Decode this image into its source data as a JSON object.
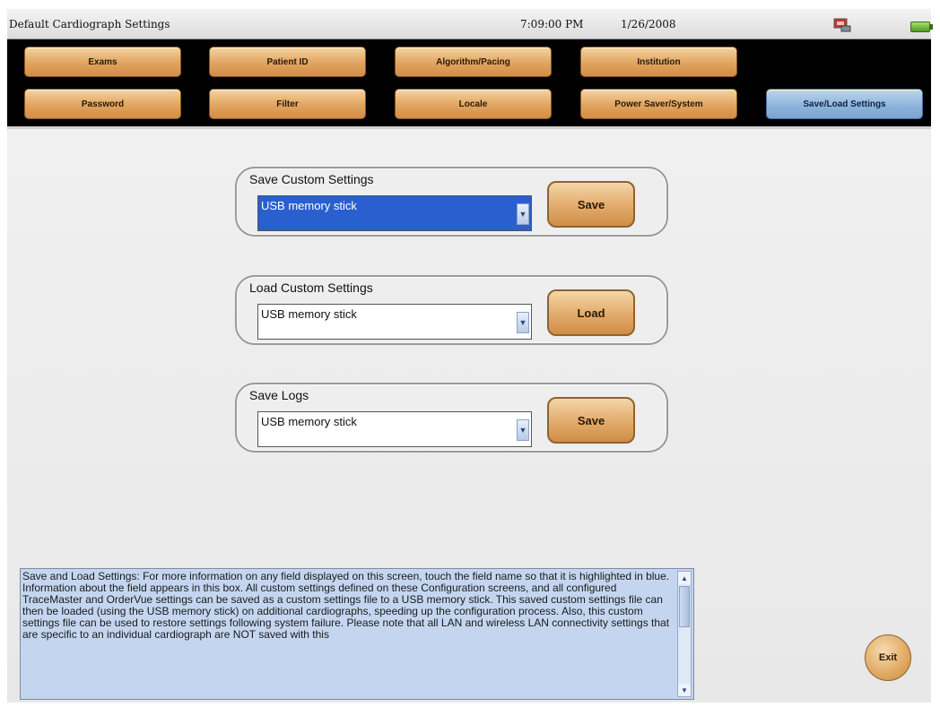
{
  "window": {
    "title": "Default Cardiograph Settings",
    "time": "7:09:00 PM",
    "date": "1/26/2008"
  },
  "nav": {
    "exams": "Exams",
    "patient_id": "Patient ID",
    "algorithm_pacing": "Algorithm/Pacing",
    "institution": "Institution",
    "password": "Password",
    "filter": "Filter",
    "locale": "Locale",
    "power_saver_system": "Power Saver/System",
    "save_load_settings": "Save/Load Settings"
  },
  "save_custom": {
    "label": "Save Custom Settings",
    "selected": "USB memory stick",
    "button": "Save"
  },
  "load_custom": {
    "label": "Load Custom Settings",
    "selected": "USB memory stick",
    "button": "Load"
  },
  "save_logs": {
    "label": "Save Logs",
    "selected": "USB memory stick",
    "button": "Save"
  },
  "help": {
    "text": "Save and Load Settings: For more information on any field displayed on this screen, touch the field name so that it is highlighted in blue. Information about the field appears in this box. All custom settings defined on these Configuration screens, and all configured TraceMaster and OrderVue settings can be saved as a custom settings file to a USB memory stick. This saved custom settings file can then be loaded (using the USB memory stick) on additional cardiographs, speeding up the configuration process. Also, this custom settings file can be used to restore settings following system failure. Please note that all LAN and wireless LAN connectivity settings that are specific to an individual cardiograph are NOT saved with this"
  },
  "exit": "Exit",
  "colors": {
    "nav_button": "#e0a460",
    "nav_active": "#8fb5dc",
    "selection": "#2a5fcf",
    "help_bg": "#c4d6ef"
  }
}
